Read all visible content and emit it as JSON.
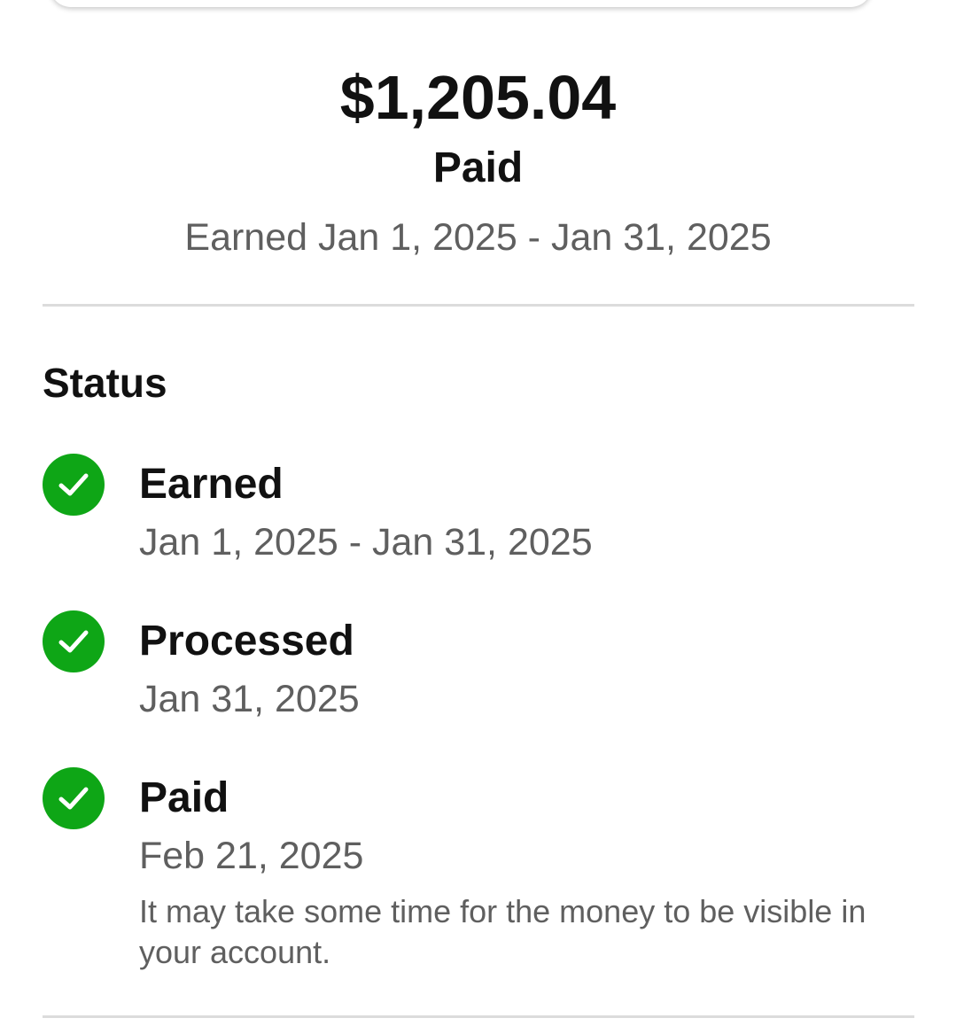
{
  "summary": {
    "amount": "$1,205.04",
    "status": "Paid",
    "earned_range": "Earned Jan 1, 2025 - Jan 31, 2025"
  },
  "status_section": {
    "heading": "Status",
    "steps": [
      {
        "title": "Earned",
        "date": "Jan 1, 2025 - Jan 31, 2025",
        "icon": "check-circle-icon",
        "completed": true
      },
      {
        "title": "Processed",
        "date": "Jan 31, 2025",
        "icon": "check-circle-icon",
        "completed": true
      },
      {
        "title": "Paid",
        "date": "Feb 21, 2025",
        "note": "It may take some time for the money to be visible in your account.",
        "icon": "check-circle-icon",
        "completed": true
      }
    ]
  },
  "colors": {
    "success": "#0ea616",
    "primary_text": "#111111",
    "secondary_text": "#5f5f5f",
    "divider": "#dcdcdc"
  }
}
